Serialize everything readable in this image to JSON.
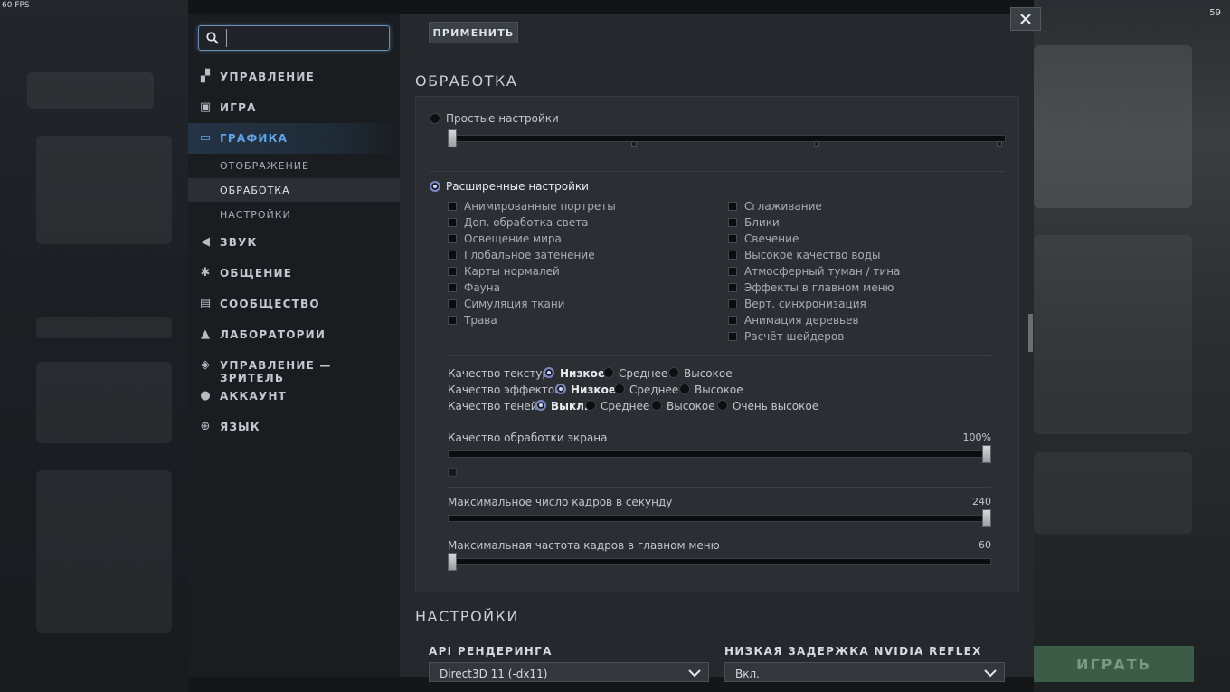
{
  "hud": {
    "fps_left": "60 FPS",
    "fps_right": "59"
  },
  "search": {
    "placeholder": "",
    "value": ""
  },
  "sidebar": {
    "items": [
      {
        "label": "УПРАВЛЕНИЕ",
        "icon": "controls-icon"
      },
      {
        "label": "ИГРА",
        "icon": "game-icon"
      },
      {
        "label": "ГРАФИКА",
        "icon": "monitor-icon",
        "active": true
      },
      {
        "label": "ЗВУК",
        "icon": "speaker-icon"
      },
      {
        "label": "ОБЩЕНИЕ",
        "icon": "gear-icon"
      },
      {
        "label": "СООБЩЕСТВО",
        "icon": "chat-icon"
      },
      {
        "label": "ЛАБОРАТОРИИ",
        "icon": "flask-icon"
      },
      {
        "label": "УПРАВЛЕНИЕ — ЗРИТЕЛЬ",
        "icon": "eye-icon"
      },
      {
        "label": "АККАУНТ",
        "icon": "user-icon"
      },
      {
        "label": "ЯЗЫК",
        "icon": "globe-icon"
      }
    ],
    "subitems": [
      "ОТОБРАЖЕНИЕ",
      "ОБРАБОТКА",
      "НАСТРОЙКИ"
    ]
  },
  "apply_label": "ПРИМЕНИТЬ",
  "processing": {
    "title": "ОБРАБОТКА",
    "simple_label": "Простые настройки",
    "advanced_label": "Расширенные настройки",
    "checks_left": [
      "Анимированные портреты",
      "Доп. обработка света",
      "Освещение мира",
      "Глобальное затенение",
      "Карты нормалей",
      "Фауна",
      "Симуляция ткани",
      "Трава"
    ],
    "checks_right": [
      "Сглаживание",
      "Блики",
      "Свечение",
      "Высокое качество воды",
      "Атмосферный туман / тина",
      "Эффекты в главном меню",
      "Верт. синхронизация",
      "Анимация деревьев",
      "Расчёт шейдеров"
    ],
    "texture": {
      "label": "Качество текстур",
      "options": [
        "Низкое",
        "Среднее",
        "Высокое"
      ],
      "selected": 0
    },
    "effects": {
      "label": "Качество эффектов",
      "options": [
        "Низкое",
        "Среднее",
        "Высокое"
      ],
      "selected": 0
    },
    "shadows": {
      "label": "Качество теней",
      "options": [
        "Выкл.",
        "Среднее",
        "Высокое",
        "Очень высокое"
      ],
      "selected": 0
    },
    "screen_quality": {
      "label": "Качество обработки экрана",
      "value": "100%",
      "level": 1.0
    },
    "max_fps": {
      "label": "Максимальное число кадров в секунду",
      "value": "240",
      "level": 1.0
    },
    "menu_fps": {
      "label": "Максимальная частота кадров в главном меню",
      "value": "60",
      "level": 0.0
    }
  },
  "settings": {
    "title": "НАСТРОЙКИ",
    "render_api": {
      "label": "API РЕНДЕРИНГА",
      "value": "Direct3D 11 (-dx11)"
    },
    "reflex": {
      "label": "НИЗКАЯ ЗАДЕРЖКА NVIDIA REFLEX",
      "value": "Вкл."
    }
  },
  "play_label": "ИГРАТЬ",
  "colors": {
    "accent": "#5fa3e8",
    "panel": "#2b2f33",
    "sidebar": "#1a1d20"
  }
}
